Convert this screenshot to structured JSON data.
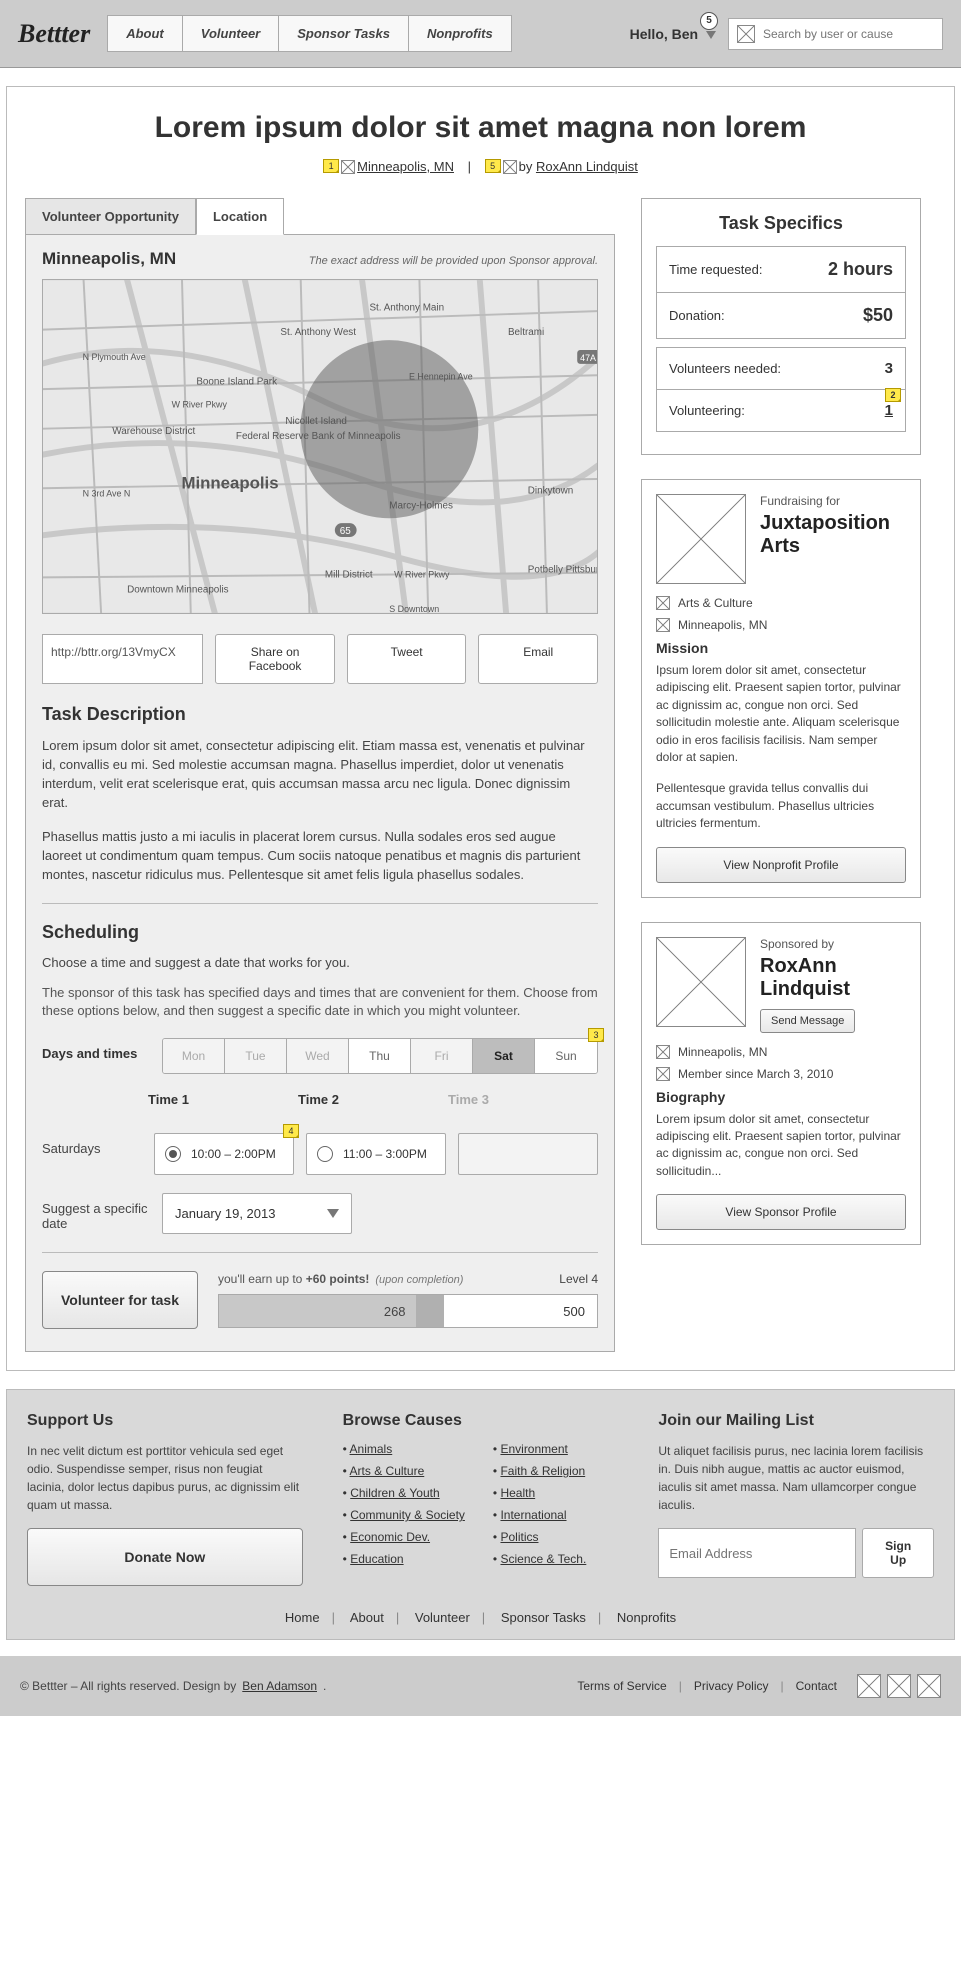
{
  "header": {
    "logo": "Bettter",
    "nav": [
      "About",
      "Volunteer",
      "Sponsor Tasks",
      "Nonprofits"
    ],
    "greeting": "Hello, Ben",
    "notif_count": "5",
    "search_placeholder": "Search by user or cause"
  },
  "page": {
    "title": "Lorem ipsum dolor sit amet magna non lorem",
    "location_link": "Minneapolis, MN",
    "by_prefix": "by ",
    "author_link": "RoxAnn Lindquist",
    "note1": "1",
    "note5": "5"
  },
  "tabs": {
    "opportunity": "Volunteer Opportunity",
    "location": "Location"
  },
  "location_panel": {
    "city": "Minneapolis, MN",
    "hint": "The exact address will be provided upon Sponsor approval.",
    "share_url": "http://bttr.org/13VmyCX",
    "btn_fb": "Share on Facebook",
    "btn_tw": "Tweet",
    "btn_em": "Email"
  },
  "task_desc": {
    "heading": "Task Description",
    "p1": "Lorem ipsum dolor sit amet, consectetur adipiscing elit. Etiam massa est, venenatis et pulvinar id, convallis eu mi. Sed molestie accumsan magna. Phasellus imperdiet, dolor ut venenatis interdum, velit erat scelerisque erat, quis accumsan massa arcu nec ligula. Donec dignissim erat.",
    "p2": "Phasellus mattis justo a mi iaculis in placerat lorem cursus. Nulla sodales eros sed augue laoreet ut condimentum quam tempus. Cum sociis natoque penatibus et magnis dis parturient montes, nascetur ridiculus mus. Pellentesque sit amet felis ligula phasellus sodales."
  },
  "scheduling": {
    "heading": "Scheduling",
    "intro": "Choose a time and suggest a date that works for you.",
    "para": "The sponsor of this task has specified days and times that are convenient for them. Choose from these options below, and then suggest a specific date in which you might volunteer.",
    "days_label": "Days and times",
    "days": [
      "Mon",
      "Tue",
      "Wed",
      "Thu",
      "Fri",
      "Sat",
      "Sun"
    ],
    "note3": "3",
    "time_heads": [
      "Time 1",
      "Time 2",
      "Time 3"
    ],
    "row_label": "Saturdays",
    "slot1": "10:00 – 2:00PM",
    "slot2": "11:00 – 3:00PM",
    "note4": "4",
    "date_label": "Suggest a specific date",
    "date_value": "January 19, 2013"
  },
  "volunteer": {
    "button": "Volunteer for task",
    "points_pre": "you'll earn up to ",
    "points_bold": "+60 points!",
    "points_note": "(upon completion)",
    "level": "Level 4",
    "current": "268",
    "max": "500"
  },
  "specifics": {
    "heading": "Task Specifics",
    "rows1": [
      {
        "label": "Time requested:",
        "value": "2 hours"
      },
      {
        "label": "Donation:",
        "value": "$50"
      }
    ],
    "rows2": [
      {
        "label": "Volunteers needed:",
        "value": "3"
      },
      {
        "label": "Volunteering:",
        "value": "1"
      }
    ],
    "note2": "2"
  },
  "nonprofit": {
    "over": "Fundraising for",
    "name": "Juxtaposition Arts",
    "cat": "Arts & Culture",
    "loc": "Minneapolis, MN",
    "mission_h": "Mission",
    "mission1": "Ipsum lorem dolor sit amet, consectetur adipiscing elit. Praesent sapien tortor, pulvinar ac dignissim ac, congue non orci. Sed sollicitudin molestie ante. Aliquam scelerisque odio in eros facilisis facilisis. Nam semper dolor at sapien.",
    "mission2": "Pellentesque gravida tellus convallis dui accumsan vestibulum. Phasellus ultricies ultricies fermentum.",
    "btn": "View Nonprofit Profile"
  },
  "sponsor": {
    "over": "Sponsored by",
    "name": "RoxAnn Lindquist",
    "msg_btn": "Send Message",
    "loc": "Minneapolis, MN",
    "since": "Member since March 3, 2010",
    "bio_h": "Biography",
    "bio": "Lorem ipsum dolor sit amet, consectetur adipiscing elit. Praesent sapien tortor, pulvinar ac dignissim ac, congue non orci. Sed sollicitudin...",
    "btn": "View Sponsor Profile"
  },
  "footer": {
    "support_h": "Support Us",
    "support_p": "In nec velit dictum est porttitor vehicula sed eget odio. Suspendisse semper, risus non feugiat lacinia, dolor lectus dapibus purus, ac dignissim elit quam ut massa.",
    "donate": "Donate Now",
    "browse_h": "Browse Causes",
    "causes_a": [
      "Animals",
      "Arts & Culture",
      "Children & Youth",
      "Community & Society",
      "Economic Dev.",
      "Education"
    ],
    "causes_b": [
      "Environment",
      "Faith & Religion",
      "Health",
      "International",
      "Politics",
      "Science & Tech."
    ],
    "mail_h": "Join our Mailing List",
    "mail_p": "Ut aliquet facilisis purus, nec lacinia lorem facilisis in. Duis nibh augue, mattis ac auctor euismod, iaculis sit amet massa. Nam ullamcorper congue iaculis.",
    "mail_placeholder": "Email Address",
    "signup": "Sign Up",
    "nav": [
      "Home",
      "About",
      "Volunteer",
      "Sponsor Tasks",
      "Nonprofits"
    ]
  },
  "bottom": {
    "copy": "© Bettter – All rights reserved.   Design by ",
    "designer": "Ben Adamson",
    "tos": "Terms of Service",
    "pp": "Privacy Policy",
    "contact": "Contact"
  }
}
